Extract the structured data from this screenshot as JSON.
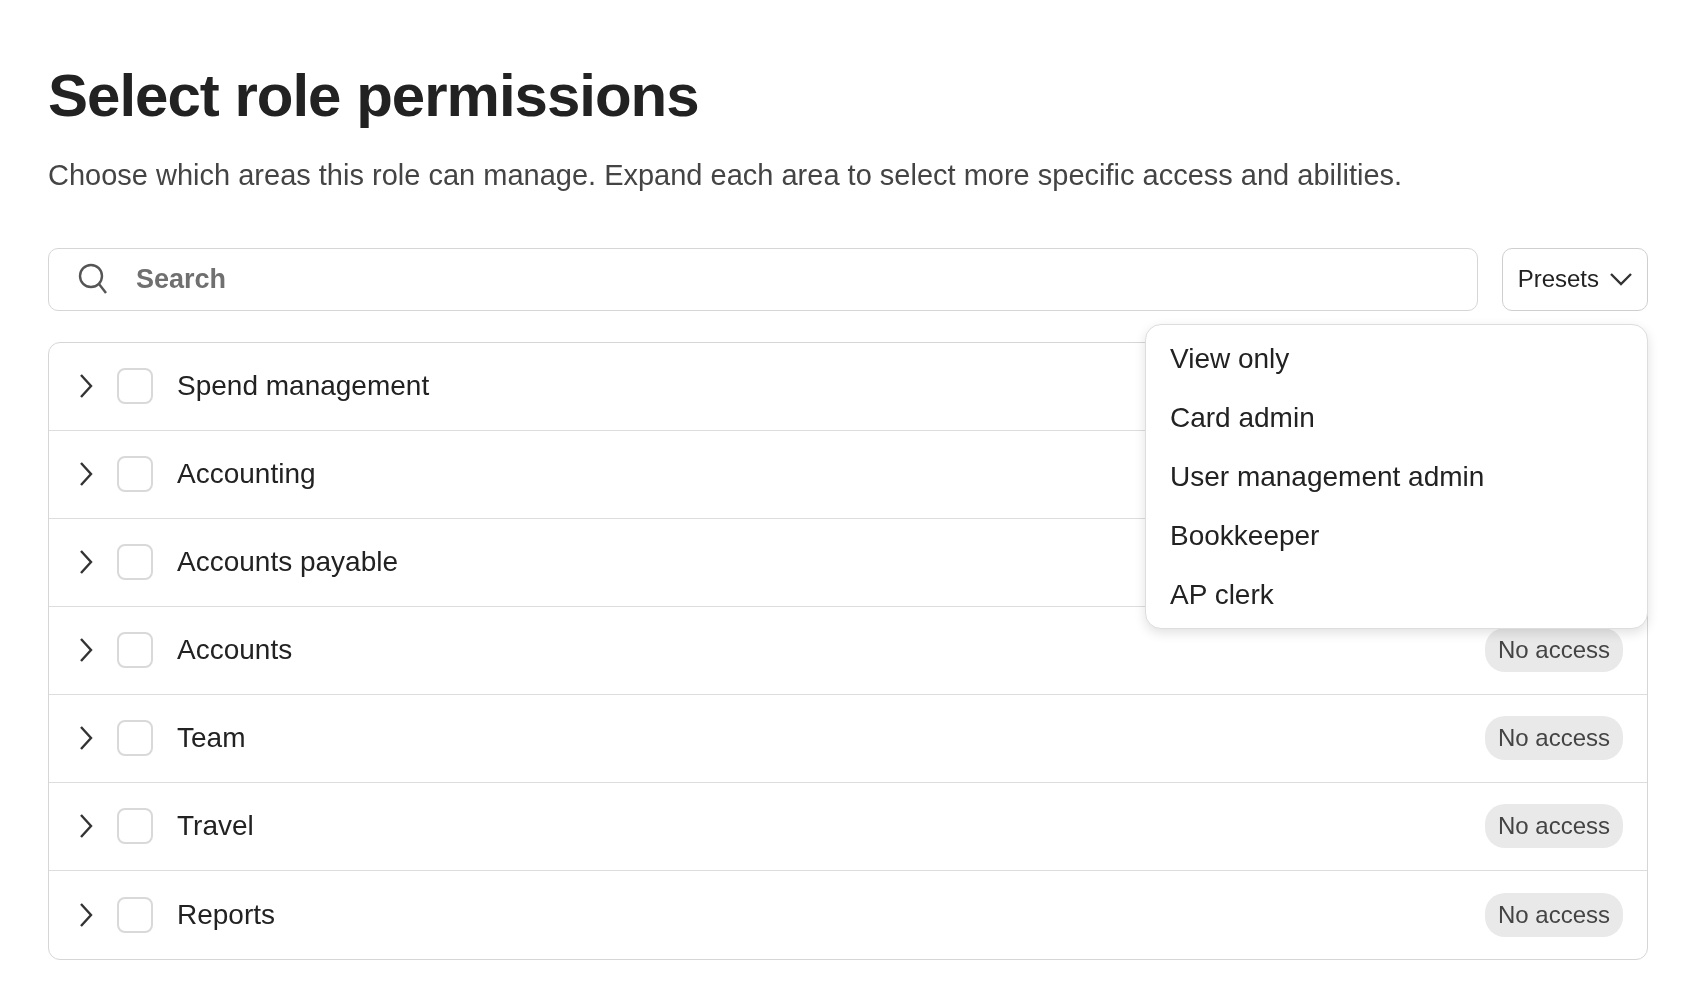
{
  "title": "Select role permissions",
  "subtitle": "Choose which areas this role can manage. Expand each area to select more specific access and abilities.",
  "search": {
    "placeholder": "Search"
  },
  "presets": {
    "label": "Presets",
    "expanded": true,
    "options": [
      "View only",
      "Card admin",
      "User management admin",
      "Bookkeeper",
      "AP clerk"
    ]
  },
  "areas": [
    {
      "name": "Spend management",
      "checked": false,
      "expanded": false
    },
    {
      "name": "Accounting",
      "checked": false,
      "expanded": false
    },
    {
      "name": "Accounts payable",
      "checked": false,
      "expanded": false
    },
    {
      "name": "Accounts",
      "checked": false,
      "expanded": false,
      "access": "No access"
    },
    {
      "name": "Team",
      "checked": false,
      "expanded": false,
      "access": "No access"
    },
    {
      "name": "Travel",
      "checked": false,
      "expanded": false,
      "access": "No access"
    },
    {
      "name": "Reports",
      "checked": false,
      "expanded": false,
      "access": "No access"
    }
  ]
}
